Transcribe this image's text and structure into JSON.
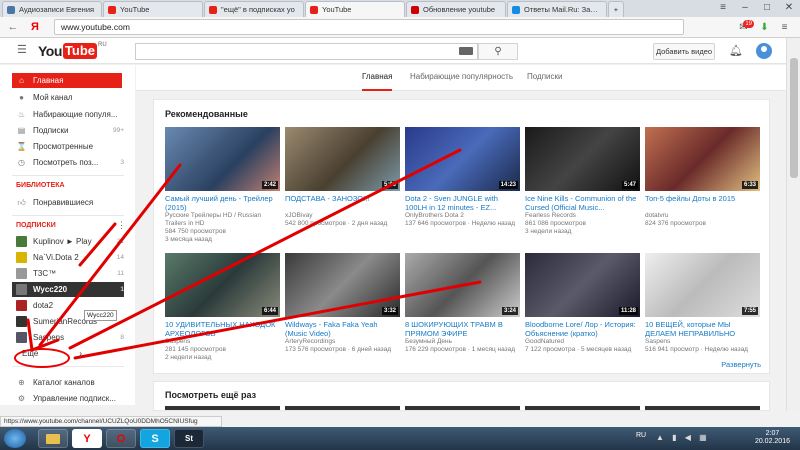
{
  "browser": {
    "tabs": [
      {
        "label": "Аудиозаписи Евгения",
        "color": "#4a76a8"
      },
      {
        "label": "YouTube",
        "color": "#e62117"
      },
      {
        "label": "\"ещё\" в подписках yo",
        "color": "#e62117"
      },
      {
        "label": "YouTube",
        "color": "#e62117"
      },
      {
        "label": "Обновление youtube",
        "color": "#c00"
      },
      {
        "label": "Ответы Mail.Ru: Задал",
        "color": "#168de2"
      }
    ],
    "url": "www.youtube.com",
    "back_icon": "back-arrow-icon",
    "yandex_label": "Я",
    "mail_badge": "19"
  },
  "header": {
    "logo_you": "You",
    "logo_tube": "Tube",
    "logo_region": "RU",
    "upload_label": "Добавить видео"
  },
  "sidebar": {
    "nav": [
      {
        "label": "Главная",
        "icon": "home-icon",
        "active": true,
        "count": ""
      },
      {
        "label": "Мой канал",
        "icon": "user-icon",
        "count": ""
      },
      {
        "label": "Набирающие популя...",
        "icon": "fire-icon",
        "count": ""
      },
      {
        "label": "Подписки",
        "icon": "subscriptions-icon",
        "count": "99+"
      },
      {
        "label": "Просмотренные",
        "icon": "history-icon",
        "count": ""
      },
      {
        "label": "Посмотреть поз...",
        "icon": "clock-icon",
        "count": "3"
      }
    ],
    "library_heading": "БИБЛИОТЕКА",
    "library": [
      {
        "label": "Понравившиеся",
        "icon": "thumbs-up-icon"
      }
    ],
    "subs_heading": "ПОДПИСКИ",
    "subscriptions": [
      {
        "label": "Kuplinov ► Play",
        "count": "21",
        "color": "#4a7a3a"
      },
      {
        "label": "Na`Vi.Dota 2",
        "count": "14",
        "color": "#d8b400"
      },
      {
        "label": "T3C™",
        "count": "11",
        "color": "#999"
      },
      {
        "label": "Wycc220",
        "count": "1",
        "color": "#555",
        "selected": true
      },
      {
        "label": "dota2",
        "count": "",
        "color": "#a22"
      },
      {
        "label": "SumerianRecords",
        "count": "",
        "color": "#333"
      },
      {
        "label": "Saspens",
        "count": "8",
        "color": "#556"
      }
    ],
    "tooltip": "Wycc220",
    "more_label": "Ещё",
    "footer": [
      {
        "label": "Каталог каналов",
        "icon": "plus-circle-icon"
      },
      {
        "label": "Управление подписк...",
        "icon": "gear-icon"
      }
    ]
  },
  "feed_tabs": [
    "Главная",
    "Набирающие популярность",
    "Подписки"
  ],
  "recommended": {
    "title": "Рекомендованные",
    "expand_label": "Развернуть",
    "videos": [
      {
        "title": "Самый лучший день - Трейлер (2015)",
        "channel": "Русские Трейлеры HD / Russian Trailers in HD",
        "views": "584 750 просмотров",
        "age": "3 месяца назад",
        "duration": "2:42",
        "bg": "#4a6a8a"
      },
      {
        "title": "ПОДСТАВА - ЗАНОЗО!!!",
        "channel": "xJOBivay",
        "views": "542 800 просмотров",
        "age": "2 дня назад",
        "duration": "5:03",
        "bg": "#6a6050"
      },
      {
        "title": "Dota 2 - Sven JUNGLE with 100LH in 12 minutes - EZ...",
        "channel": "OnlyBrothers Dota 2",
        "views": "137 646 просмотров",
        "age": "Неделю назад",
        "duration": "14:23",
        "bg": "#3a4a7a"
      },
      {
        "title": "Ice Nine Kills - Communion of the Cursed (Official Music...",
        "channel": "Fearless Records",
        "views": "861 086 просмотров",
        "age": "3 недели назад",
        "duration": "5:47",
        "bg": "#2a2a2a"
      },
      {
        "title": "Топ-5 фейлы Доты в 2015",
        "channel": "dotatvru",
        "views": "824 376 просмотров",
        "age": "",
        "duration": "6:33",
        "bg": "#8a4a3a"
      },
      {
        "title": "10 УДИВИТЕЛЬНЫХ НАХОДОК АРХЕОЛОГОВ",
        "channel": "Saspens",
        "views": "281 145 просмотров",
        "age": "2 недели назад",
        "duration": "6:44",
        "bg": "#3a5a4a"
      },
      {
        "title": "Wildways - Faka Faka Yeah (Music Video)",
        "channel": "ArteryRecordings",
        "views": "173 576 просмотров",
        "age": "6 дней назад",
        "duration": "3:32",
        "bg": "#5a5a5a"
      },
      {
        "title": "8 ШОКИРУЮЩИХ ТРАВМ В ПРЯМОМ ЭФИРЕ",
        "channel": "Безумный День",
        "views": "176 229 просмотров",
        "age": "1 месяц назад",
        "duration": "3:24",
        "bg": "#707070"
      },
      {
        "title": "Bloodborne Lore/ Лор - История: Объяснение (кратко)",
        "channel": "GoodNatured",
        "views": "7 122 просмотра",
        "age": "5 месяцев назад",
        "duration": "11:28",
        "bg": "#3a3a4a"
      },
      {
        "title": "10 ВЕЩЕЙ, которые МЫ ДЕЛАЕМ НЕПРАВИЛЬНО",
        "channel": "Saspens",
        "views": "516 941 просмотр",
        "age": "Неделю назад",
        "duration": "7:55",
        "bg": "#c8c8c8"
      }
    ]
  },
  "watch_again": {
    "title": "Посмотреть ещё раз"
  },
  "status_url": "https://www.youtube.com/channel/UCUZLQoU0DDMhO5CNIUSfug",
  "taskbar": {
    "icons": [
      "folder-icon",
      "yandex-icon",
      "opera-icon",
      "skype-icon",
      "steam-icon"
    ],
    "yandex_letter": "Y",
    "opera_letter": "O",
    "skype_letter": "S",
    "steam_letter": "St",
    "lang": "RU",
    "time": "2:07",
    "date": "20.02.2016"
  },
  "colors": {
    "accent": "#e62117",
    "link": "#167ac6",
    "annotation": "#e00000"
  }
}
